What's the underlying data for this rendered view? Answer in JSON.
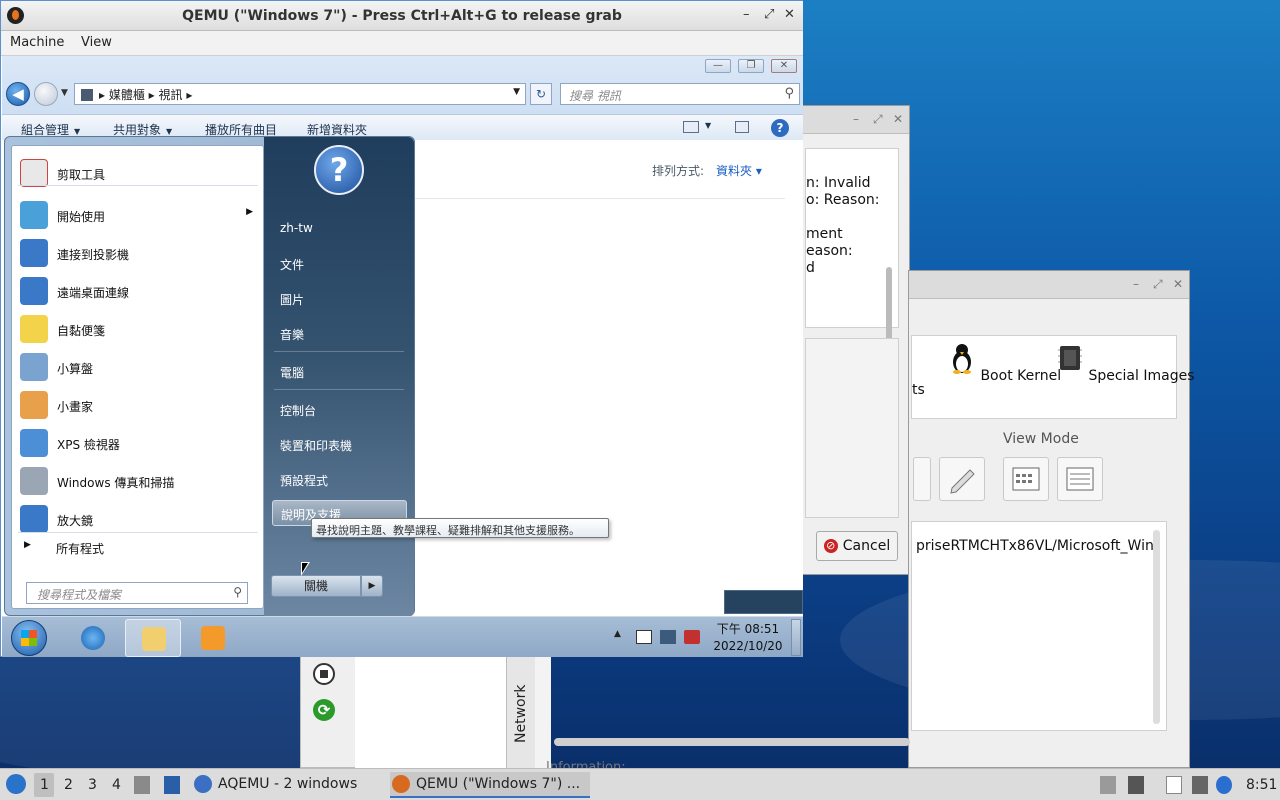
{
  "bg_dialog": {
    "error_text": "n: Invalid\no: Reason:\n\nment\neason:\nd",
    "cancel_label": "Cancel"
  },
  "aqemu_dialog": {
    "tiles": [
      {
        "label": "ts"
      },
      {
        "label": "Boot Kernel"
      },
      {
        "label": "Special Images"
      }
    ],
    "view_mode_label": "View Mode",
    "path_text": "priseRTMCHTx86VL/Microsoft_Win",
    "network_tab": "Network",
    "information_label": "Information:"
  },
  "qemu_window": {
    "title": "QEMU (\"Windows 7\") - Press Ctrl+Alt+G to release grab",
    "controls": [
      "–",
      "⤢",
      "✕"
    ],
    "menu": [
      "Machine",
      "View"
    ]
  },
  "explorer": {
    "caption_buttons": [
      "—",
      "❐",
      "✕"
    ],
    "address_parts": [
      "媒體櫃",
      "視訊"
    ],
    "search_placeholder": "搜尋 視訊",
    "commands": [
      "組合管理",
      "共用對象",
      "播放所有曲目",
      "新增資料夾"
    ],
    "sort_label": "排列方式:",
    "sort_value": "資料夾"
  },
  "start_menu": {
    "left_items": [
      {
        "label": "剪取工具",
        "color": "#e8e8e8"
      },
      {
        "label": "開始使用",
        "color": "#4aa0d8",
        "submenu": "▶"
      },
      {
        "label": "連接到投影機",
        "color": "#3a78c8"
      },
      {
        "label": "遠端桌面連線",
        "color": "#3a78c8"
      },
      {
        "label": "自黏便箋",
        "color": "#f2d34a"
      },
      {
        "label": "小算盤",
        "color": "#7aa4cf"
      },
      {
        "label": "小畫家",
        "color": "#e9a04a"
      },
      {
        "label": "XPS 檢視器",
        "color": "#4c8fd6"
      },
      {
        "label": "Windows 傳真和掃描",
        "color": "#9aa6b4"
      },
      {
        "label": "放大鏡",
        "color": "#3a78c8"
      }
    ],
    "all_programs": "所有程式",
    "search_placeholder": "搜尋程式及檔案",
    "user_icon": "?",
    "right_items": [
      "zh-tw",
      "文件",
      "圖片",
      "音樂",
      "電腦",
      "控制台",
      "裝置和印表機",
      "預設程式",
      "說明及支援"
    ],
    "shutdown_label": "關機",
    "tooltip": "尋找說明主題、教學課程、疑難排解和其他支援服務。"
  },
  "guest_taskbar": {
    "clock_time": "下午 08:51",
    "clock_date": "2022/10/20"
  },
  "host_taskbar": {
    "workspaces": [
      "1",
      "2",
      "3",
      "4"
    ],
    "tasks": [
      {
        "label": "AQEMU - 2 windows"
      },
      {
        "label": "QEMU (\"Windows 7\") ..."
      }
    ],
    "clock": "8:51"
  }
}
